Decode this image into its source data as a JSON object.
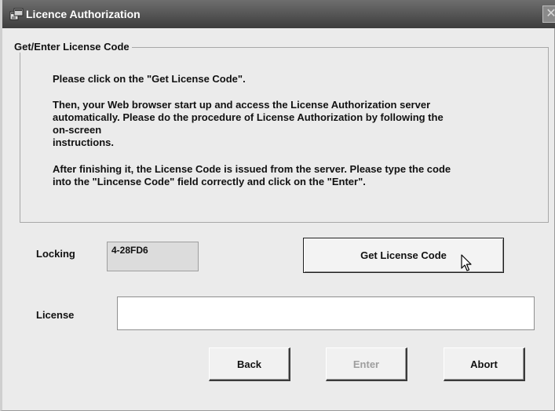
{
  "window": {
    "title": "Licence Authorization",
    "close_symbol": "✕",
    "icon": "app-window-icon"
  },
  "group": {
    "legend": "Get/Enter License Code",
    "instructions": [
      "Please click on the \"Get License Code\".",
      "Then, your Web browser start up and access the License Authorization server\nautomatically. Please do the procedure of License Authorization by following the\non-screen\ninstructions.",
      "After finishing it, the License Code is issued from the server. Please type the code\ninto the \"Lincense Code\" field correctly and click on the \"Enter\"."
    ]
  },
  "locking": {
    "label": "Locking",
    "value": "4-28FD6"
  },
  "license": {
    "label": "License",
    "value": "",
    "placeholder": ""
  },
  "buttons": {
    "get_license_code": "Get License Code",
    "back": "Back",
    "enter": "Enter",
    "abort": "Abort"
  },
  "state": {
    "enter_enabled": false
  },
  "icons": {
    "cursor": "mouse-pointer-icon"
  }
}
